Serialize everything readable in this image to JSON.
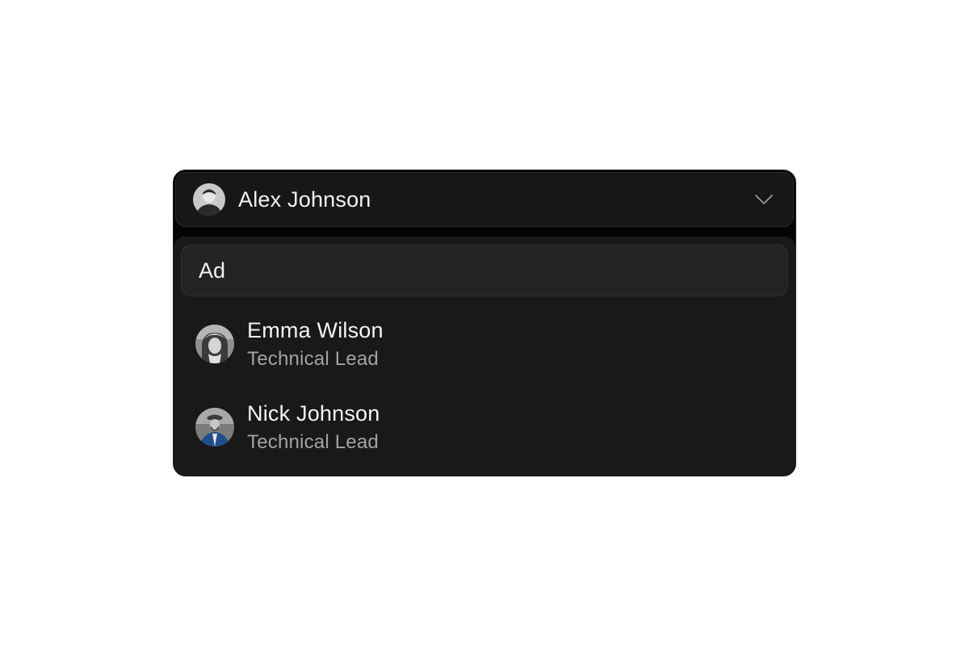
{
  "selected": {
    "name": "Alex Johnson",
    "avatar_icon": "person-avatar-icon"
  },
  "search": {
    "value": "Ad",
    "placeholder": ""
  },
  "options": [
    {
      "name": "Emma Wilson",
      "role": "Technical Lead",
      "avatar_icon": "person-avatar-icon"
    },
    {
      "name": "Nick Johnson",
      "role": "Technical Lead",
      "avatar_icon": "person-avatar-icon"
    }
  ],
  "icons": {
    "toggle": "chevron-down-icon"
  },
  "colors": {
    "background": "#ffffff",
    "surface": "#191919",
    "trigger": "#171717",
    "input": "#232323",
    "text_primary": "#f2f2f2",
    "text_secondary": "#a3a3a3",
    "option_avatar_accent": "#1f4e8c"
  }
}
